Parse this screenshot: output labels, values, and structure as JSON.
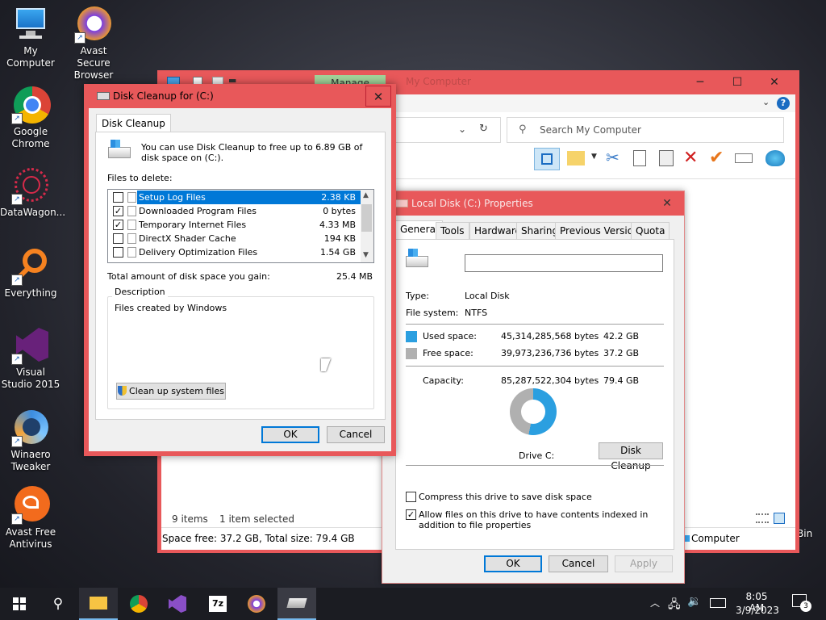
{
  "desktop": {
    "icons": [
      {
        "label": "My Computer",
        "icon": "computer-icon"
      },
      {
        "label": "Avast Secure Browser",
        "icon": "avast-browser-icon"
      },
      {
        "label": "Google Chrome",
        "icon": "chrome-icon"
      },
      {
        "label": "DataWagon...",
        "icon": "datawagon-icon"
      },
      {
        "label": "Everything",
        "icon": "everything-icon"
      },
      {
        "label": "Visual Studio 2015",
        "icon": "visual-studio-icon"
      },
      {
        "label": "Winaero Tweaker",
        "icon": "winaero-icon"
      },
      {
        "label": "Avast Free Antivirus",
        "icon": "avast-antivirus-icon"
      }
    ],
    "recycle_label": "Bin"
  },
  "explorer": {
    "title": "My Computer",
    "ribbon_tab": "Manage",
    "search_placeholder": "Search My Computer",
    "status_items": "9 items",
    "status_selected": "1 item selected",
    "status_space": "Space free: 37.2 GB, Total size: 79.4 GB",
    "nav_computer": "Computer"
  },
  "cleanup": {
    "title": "Disk Cleanup for  (C:)",
    "tab": "Disk Cleanup",
    "intro": "You can use Disk Cleanup to free up to 6.89 GB of disk space on  (C:).",
    "files_to_delete": "Files to delete:",
    "files": [
      {
        "name": "Setup Log Files",
        "size": "2.38 KB",
        "checked": false,
        "selected": true
      },
      {
        "name": "Downloaded Program Files",
        "size": "0 bytes",
        "checked": true,
        "selected": false
      },
      {
        "name": "Temporary Internet Files",
        "size": "4.33 MB",
        "checked": true,
        "selected": false
      },
      {
        "name": "DirectX Shader Cache",
        "size": "194 KB",
        "checked": false,
        "selected": false
      },
      {
        "name": "Delivery Optimization Files",
        "size": "1.54 GB",
        "checked": false,
        "selected": false
      }
    ],
    "total_label": "Total amount of disk space you gain:",
    "total_value": "25.4 MB",
    "description_label": "Description",
    "description_text": "Files created by Windows",
    "system_files_btn": "Clean up system files",
    "ok": "OK",
    "cancel": "Cancel"
  },
  "props": {
    "title": "Local Disk (C:) Properties",
    "tabs": [
      "General",
      "Tools",
      "Hardware",
      "Sharing",
      "Previous Versions",
      "Quota"
    ],
    "type_label": "Type:",
    "type_value": "Local Disk",
    "fs_label": "File system:",
    "fs_value": "NTFS",
    "used_label": "Used space:",
    "used_bytes": "45,314,285,568 bytes",
    "used_gb": "42.2 GB",
    "free_label": "Free space:",
    "free_bytes": "39,973,236,736 bytes",
    "free_gb": "37.2 GB",
    "cap_label": "Capacity:",
    "cap_bytes": "85,287,522,304 bytes",
    "cap_gb": "79.4 GB",
    "used_fraction": 0.531,
    "used_color": "#2b9fe0",
    "free_color": "#b0b0b0",
    "drive_label": "Drive C:",
    "cleanup_btn": "Disk Cleanup",
    "compress": "Compress this drive to save disk space",
    "index": "Allow files on this drive to have contents indexed in addition to file properties",
    "ok": "OK",
    "cancel": "Cancel",
    "apply": "Apply"
  },
  "taskbar": {
    "time": "8:05 AM",
    "date": "3/9/2023",
    "notifications": "3"
  }
}
